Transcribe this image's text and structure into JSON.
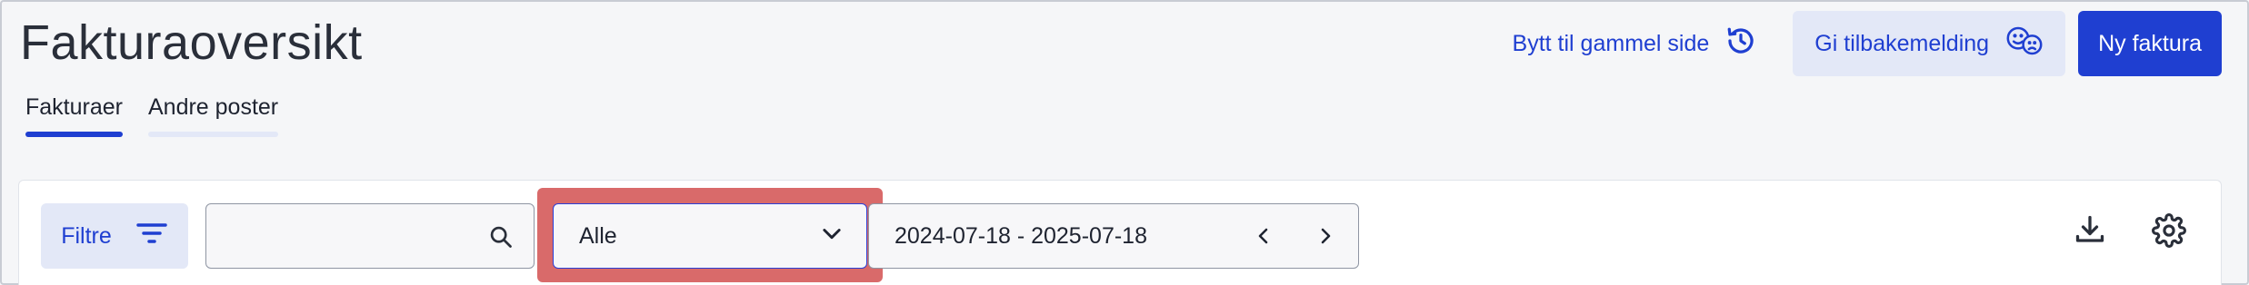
{
  "header": {
    "title": "Fakturaoversikt",
    "switch_old_label": "Bytt til gammel side",
    "feedback_label": "Gi tilbakemelding",
    "new_invoice_label": "Ny faktura"
  },
  "tabs": [
    {
      "label": "Fakturaer",
      "active": true
    },
    {
      "label": "Andre poster",
      "active": false
    }
  ],
  "filters": {
    "filter_button_label": "Filtre",
    "search": {
      "value": "",
      "placeholder": ""
    },
    "status_select": {
      "selected": "Alle"
    },
    "date_range": "2024-07-18 - 2025-07-18"
  },
  "icons": {
    "history": "history-icon",
    "feedback": "faces-icon",
    "filter": "filter-lines-icon",
    "search": "search-icon",
    "chevron": "chevron-down-icon",
    "prev": "chevron-left-icon",
    "next": "chevron-right-icon",
    "download": "download-icon",
    "settings": "gear-icon"
  },
  "colors": {
    "accent": "#1f3fd1",
    "accent_light": "#e3e8f7",
    "highlight": "#d96a6a",
    "background": "#f5f6f8"
  }
}
